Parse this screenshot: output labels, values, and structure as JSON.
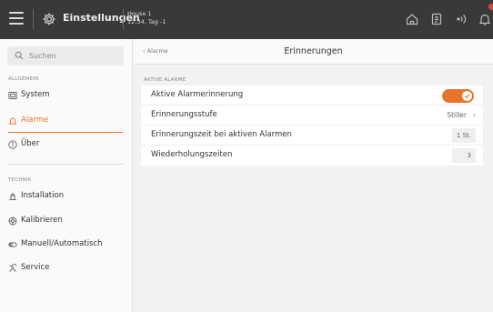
{
  "colors": {
    "accent": "#e8742c",
    "topbar": "#393939",
    "badge": "#e8442c"
  },
  "topbar": {
    "title": "Einstellungen",
    "house_name": "House 1",
    "house_status": "12:34, Tag -1",
    "icons": [
      "menu-icon",
      "gear-icon",
      "home-icon",
      "document-icon",
      "signal-icon",
      "bell-icon"
    ]
  },
  "sidebar": {
    "search_placeholder": "Suchen",
    "sections": [
      {
        "label": "ALLGEMEIN",
        "items": [
          {
            "label": "System",
            "icon": "system-icon"
          },
          {
            "label": "Alarme",
            "icon": "alarm-icon",
            "active": true
          },
          {
            "label": "Über",
            "icon": "info-icon"
          }
        ]
      },
      {
        "label": "TECHNIK",
        "items": [
          {
            "label": "Installation",
            "icon": "installation-icon"
          },
          {
            "label": "Kalibrieren",
            "icon": "calibrate-icon"
          },
          {
            "label": "Manuell/Automatisch",
            "icon": "manual-auto-icon"
          },
          {
            "label": "Service",
            "icon": "service-icon"
          }
        ]
      }
    ]
  },
  "main": {
    "back_label": "Alarme",
    "title": "Erinnerungen",
    "section_label": "AKTIVE ALARME",
    "rows": [
      {
        "label": "Aktive Alarmerinnerung",
        "type": "toggle",
        "enabled": true
      },
      {
        "label": "Erinnerungsstufe",
        "type": "select",
        "value": "Stiller"
      },
      {
        "label": "Erinnerungszeit bei aktiven Alarmen",
        "type": "value",
        "value": "1 St."
      },
      {
        "label": "Wiederholungszeiten",
        "type": "value",
        "value": "3"
      }
    ]
  }
}
